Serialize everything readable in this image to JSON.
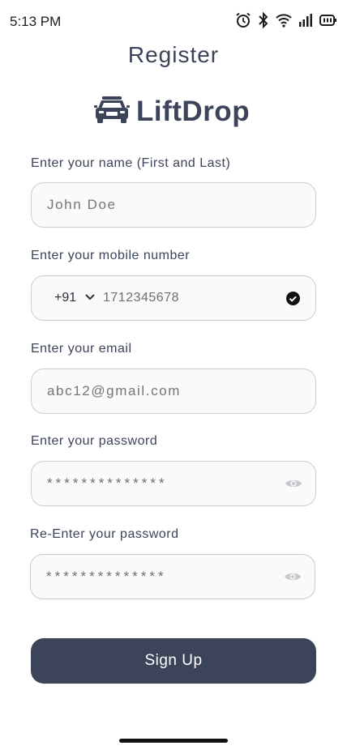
{
  "status_bar": {
    "time": "5:13 PM"
  },
  "page": {
    "title": "Register"
  },
  "brand": {
    "name": "LiftDrop",
    "icon": "car-icon"
  },
  "form": {
    "name": {
      "label": "Enter your name (First and Last)",
      "placeholder": "John Doe"
    },
    "mobile": {
      "label": "Enter your mobile number",
      "country_code": "+91",
      "value": "1712345678",
      "status": "verified"
    },
    "email": {
      "label": "Enter your email",
      "placeholder": "abc12@gmail.com"
    },
    "password": {
      "label": "Enter your password",
      "value": "**************"
    },
    "confirm_password": {
      "label": "Re-Enter your password",
      "value": "**************"
    },
    "submit_label": "Sign Up"
  },
  "colors": {
    "primary": "#3b4458",
    "field_border": "#c9ccd3",
    "field_bg": "#fafafa"
  }
}
